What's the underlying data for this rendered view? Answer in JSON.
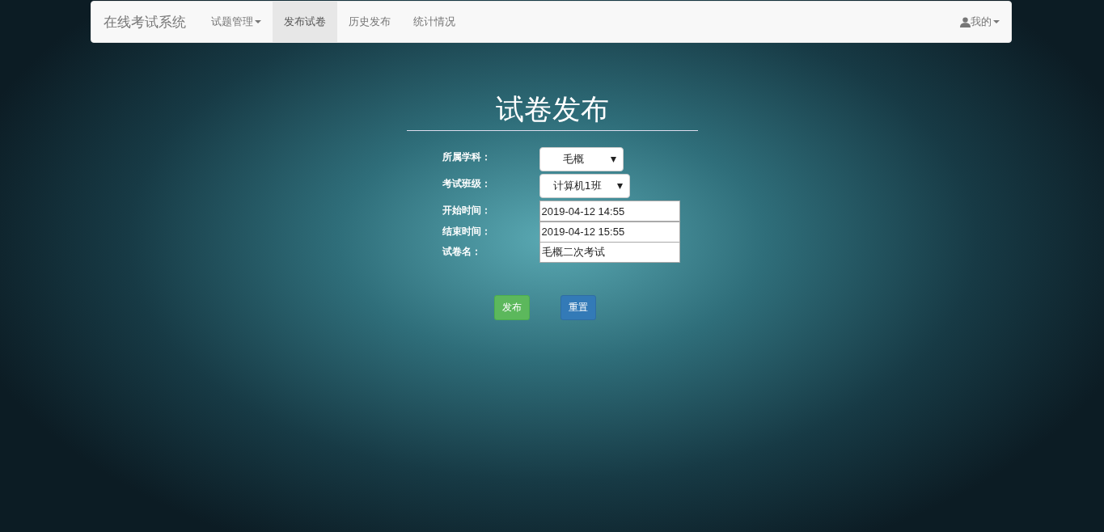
{
  "navbar": {
    "brand": "在线考试系统",
    "items": [
      {
        "label": "试题管理",
        "dropdown": true,
        "selected": false
      },
      {
        "label": "发布试卷",
        "dropdown": false,
        "selected": true
      },
      {
        "label": "历史发布",
        "dropdown": false,
        "selected": false
      },
      {
        "label": "统计情况",
        "dropdown": false,
        "selected": false
      }
    ],
    "user_menu": {
      "label": "我的"
    }
  },
  "form": {
    "title": "试卷发布",
    "fields": [
      {
        "label": "所属学科：",
        "kind": "select",
        "value": "毛概"
      },
      {
        "label": "考试班级：",
        "kind": "select",
        "value": "计算机1班"
      },
      {
        "label": "开始时间：",
        "kind": "text",
        "value": "2019-04-12 14:55"
      },
      {
        "label": "结束时间：",
        "kind": "text",
        "value": "2019-04-12 15:55"
      },
      {
        "label": "试卷名：",
        "kind": "text",
        "value": "毛概二次考试"
      }
    ],
    "buttons": [
      {
        "label": "发布",
        "kind": "success"
      },
      {
        "label": "重置",
        "kind": "primary"
      }
    ]
  }
}
